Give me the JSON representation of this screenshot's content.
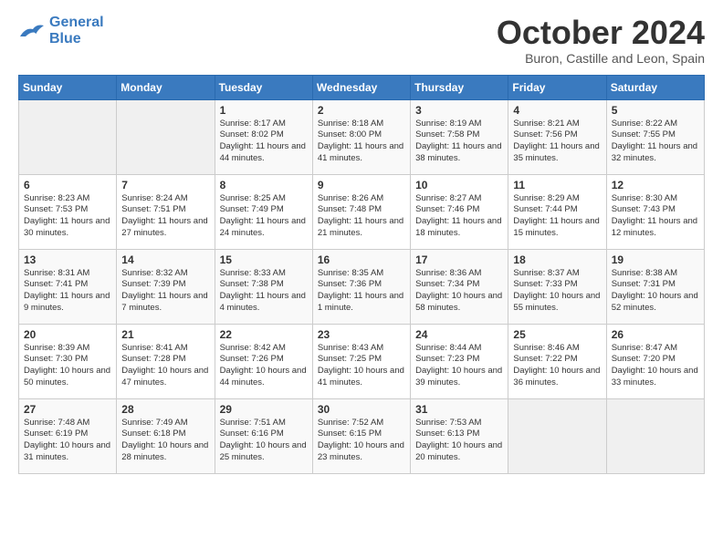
{
  "logo": {
    "line1": "General",
    "line2": "Blue"
  },
  "title": "October 2024",
  "subtitle": "Buron, Castille and Leon, Spain",
  "days_of_week": [
    "Sunday",
    "Monday",
    "Tuesday",
    "Wednesday",
    "Thursday",
    "Friday",
    "Saturday"
  ],
  "weeks": [
    [
      {
        "day": "",
        "empty": true
      },
      {
        "day": "",
        "empty": true
      },
      {
        "day": "1",
        "sunrise": "Sunrise: 8:17 AM",
        "sunset": "Sunset: 8:02 PM",
        "daylight": "Daylight: 11 hours and 44 minutes."
      },
      {
        "day": "2",
        "sunrise": "Sunrise: 8:18 AM",
        "sunset": "Sunset: 8:00 PM",
        "daylight": "Daylight: 11 hours and 41 minutes."
      },
      {
        "day": "3",
        "sunrise": "Sunrise: 8:19 AM",
        "sunset": "Sunset: 7:58 PM",
        "daylight": "Daylight: 11 hours and 38 minutes."
      },
      {
        "day": "4",
        "sunrise": "Sunrise: 8:21 AM",
        "sunset": "Sunset: 7:56 PM",
        "daylight": "Daylight: 11 hours and 35 minutes."
      },
      {
        "day": "5",
        "sunrise": "Sunrise: 8:22 AM",
        "sunset": "Sunset: 7:55 PM",
        "daylight": "Daylight: 11 hours and 32 minutes."
      }
    ],
    [
      {
        "day": "6",
        "sunrise": "Sunrise: 8:23 AM",
        "sunset": "Sunset: 7:53 PM",
        "daylight": "Daylight: 11 hours and 30 minutes."
      },
      {
        "day": "7",
        "sunrise": "Sunrise: 8:24 AM",
        "sunset": "Sunset: 7:51 PM",
        "daylight": "Daylight: 11 hours and 27 minutes."
      },
      {
        "day": "8",
        "sunrise": "Sunrise: 8:25 AM",
        "sunset": "Sunset: 7:49 PM",
        "daylight": "Daylight: 11 hours and 24 minutes."
      },
      {
        "day": "9",
        "sunrise": "Sunrise: 8:26 AM",
        "sunset": "Sunset: 7:48 PM",
        "daylight": "Daylight: 11 hours and 21 minutes."
      },
      {
        "day": "10",
        "sunrise": "Sunrise: 8:27 AM",
        "sunset": "Sunset: 7:46 PM",
        "daylight": "Daylight: 11 hours and 18 minutes."
      },
      {
        "day": "11",
        "sunrise": "Sunrise: 8:29 AM",
        "sunset": "Sunset: 7:44 PM",
        "daylight": "Daylight: 11 hours and 15 minutes."
      },
      {
        "day": "12",
        "sunrise": "Sunrise: 8:30 AM",
        "sunset": "Sunset: 7:43 PM",
        "daylight": "Daylight: 11 hours and 12 minutes."
      }
    ],
    [
      {
        "day": "13",
        "sunrise": "Sunrise: 8:31 AM",
        "sunset": "Sunset: 7:41 PM",
        "daylight": "Daylight: 11 hours and 9 minutes."
      },
      {
        "day": "14",
        "sunrise": "Sunrise: 8:32 AM",
        "sunset": "Sunset: 7:39 PM",
        "daylight": "Daylight: 11 hours and 7 minutes."
      },
      {
        "day": "15",
        "sunrise": "Sunrise: 8:33 AM",
        "sunset": "Sunset: 7:38 PM",
        "daylight": "Daylight: 11 hours and 4 minutes."
      },
      {
        "day": "16",
        "sunrise": "Sunrise: 8:35 AM",
        "sunset": "Sunset: 7:36 PM",
        "daylight": "Daylight: 11 hours and 1 minute."
      },
      {
        "day": "17",
        "sunrise": "Sunrise: 8:36 AM",
        "sunset": "Sunset: 7:34 PM",
        "daylight": "Daylight: 10 hours and 58 minutes."
      },
      {
        "day": "18",
        "sunrise": "Sunrise: 8:37 AM",
        "sunset": "Sunset: 7:33 PM",
        "daylight": "Daylight: 10 hours and 55 minutes."
      },
      {
        "day": "19",
        "sunrise": "Sunrise: 8:38 AM",
        "sunset": "Sunset: 7:31 PM",
        "daylight": "Daylight: 10 hours and 52 minutes."
      }
    ],
    [
      {
        "day": "20",
        "sunrise": "Sunrise: 8:39 AM",
        "sunset": "Sunset: 7:30 PM",
        "daylight": "Daylight: 10 hours and 50 minutes."
      },
      {
        "day": "21",
        "sunrise": "Sunrise: 8:41 AM",
        "sunset": "Sunset: 7:28 PM",
        "daylight": "Daylight: 10 hours and 47 minutes."
      },
      {
        "day": "22",
        "sunrise": "Sunrise: 8:42 AM",
        "sunset": "Sunset: 7:26 PM",
        "daylight": "Daylight: 10 hours and 44 minutes."
      },
      {
        "day": "23",
        "sunrise": "Sunrise: 8:43 AM",
        "sunset": "Sunset: 7:25 PM",
        "daylight": "Daylight: 10 hours and 41 minutes."
      },
      {
        "day": "24",
        "sunrise": "Sunrise: 8:44 AM",
        "sunset": "Sunset: 7:23 PM",
        "daylight": "Daylight: 10 hours and 39 minutes."
      },
      {
        "day": "25",
        "sunrise": "Sunrise: 8:46 AM",
        "sunset": "Sunset: 7:22 PM",
        "daylight": "Daylight: 10 hours and 36 minutes."
      },
      {
        "day": "26",
        "sunrise": "Sunrise: 8:47 AM",
        "sunset": "Sunset: 7:20 PM",
        "daylight": "Daylight: 10 hours and 33 minutes."
      }
    ],
    [
      {
        "day": "27",
        "sunrise": "Sunrise: 7:48 AM",
        "sunset": "Sunset: 6:19 PM",
        "daylight": "Daylight: 10 hours and 31 minutes."
      },
      {
        "day": "28",
        "sunrise": "Sunrise: 7:49 AM",
        "sunset": "Sunset: 6:18 PM",
        "daylight": "Daylight: 10 hours and 28 minutes."
      },
      {
        "day": "29",
        "sunrise": "Sunrise: 7:51 AM",
        "sunset": "Sunset: 6:16 PM",
        "daylight": "Daylight: 10 hours and 25 minutes."
      },
      {
        "day": "30",
        "sunrise": "Sunrise: 7:52 AM",
        "sunset": "Sunset: 6:15 PM",
        "daylight": "Daylight: 10 hours and 23 minutes."
      },
      {
        "day": "31",
        "sunrise": "Sunrise: 7:53 AM",
        "sunset": "Sunset: 6:13 PM",
        "daylight": "Daylight: 10 hours and 20 minutes."
      },
      {
        "day": "",
        "empty": true
      },
      {
        "day": "",
        "empty": true
      }
    ]
  ]
}
